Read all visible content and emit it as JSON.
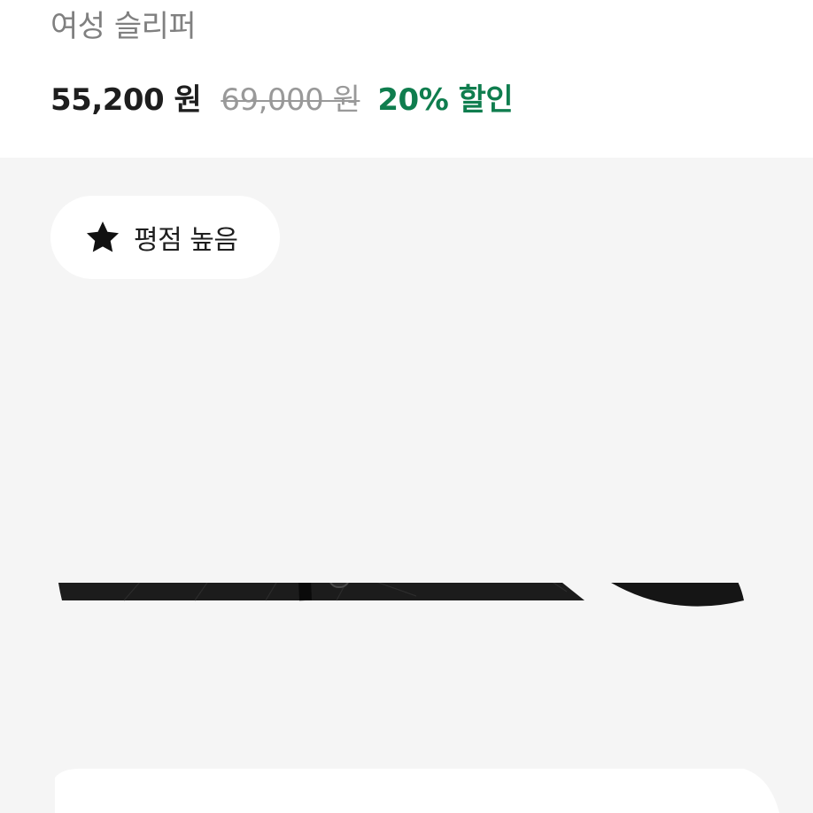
{
  "product": {
    "subtitle": "여성 슬리퍼",
    "price": "55,200 원",
    "original_price": "69,000 원",
    "discount": "20% 할인"
  },
  "badge": {
    "icon": "star-icon",
    "label": "평점 높음"
  },
  "image": {
    "subject": "slipper"
  },
  "colors": {
    "discount": "#0f7d4e",
    "muted_text": "#808080",
    "image_background": "#f5f5f5"
  }
}
